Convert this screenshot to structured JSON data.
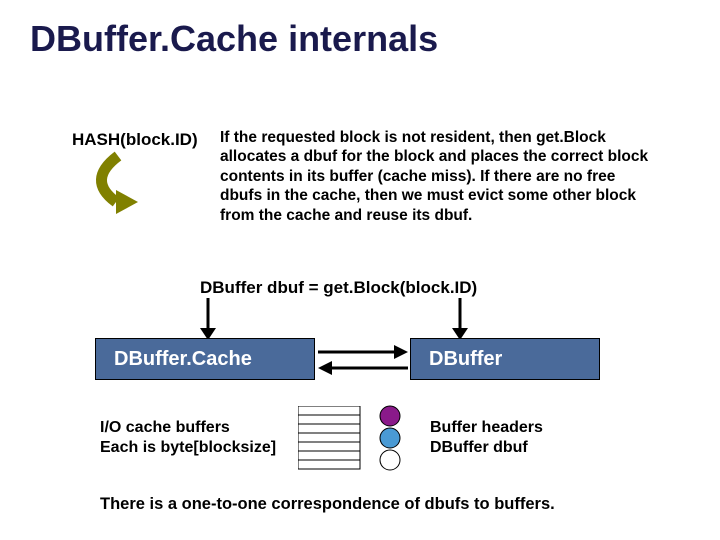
{
  "title": "DBuffer.Cache internals",
  "hash_label": "HASH(block.ID)",
  "description": "If the requested block is not resident, then get.Block allocates a dbuf for the block and places the correct block contents in its buffer (cache miss).  If there are no free dbufs in the cache, then we must evict some other block from the cache and reuse its dbuf.",
  "codeline": "DBuffer dbuf = get.Block(block.ID)",
  "box_left": "DBuffer.Cache",
  "box_right": "DBuffer",
  "io_label_1": "I/O cache buffers",
  "io_label_2": "Each is byte[blocksize]",
  "bh_label_1": "Buffer headers",
  "bh_label_2": "DBuffer dbuf",
  "bottom": "There is a one-to-one correspondence of dbufs to buffers.",
  "colors": {
    "box": "#4a6a9a",
    "title": "#1a1a4d",
    "olive": "#808000"
  }
}
